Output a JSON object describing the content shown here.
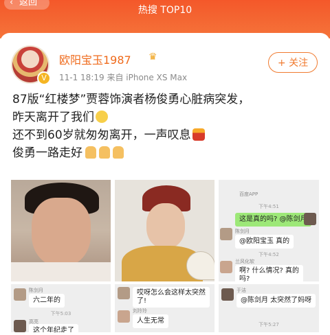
{
  "header": {
    "back_label": "返回",
    "subtitle": "热搜 TOP10"
  },
  "post": {
    "user": "欧阳宝玉1987",
    "time": "11-1 18:19",
    "source": "来自 iPhone XS Max",
    "follow_label": "+ 关注",
    "lines": [
      "87版“红楼梦”贾蓉饰演者杨俊勇心脏病突发，",
      "昨天离开了我们",
      "还不到60岁就匆匆离开，一声叹息",
      "俊勇一路走好"
    ]
  },
  "chat1": {
    "header_app": "百度APP",
    "time1": "下午4:51",
    "msg1": "这是真的吗? @陈剑月",
    "name1": "陈剑月",
    "msg2": "@欧阳宝玉 真的",
    "time2": "下午4:52",
    "name2": "兰风化软",
    "msg3a": "啊? 什么情况? 真的",
    "msg3b": "吗?"
  },
  "chat2": {
    "name": "陈剑月",
    "msg": "六二年的",
    "time": "下午5:03",
    "name2": "高亮",
    "msg2": "这个年纪走了"
  },
  "chat3": {
    "msg1": "哎呀怎么会这样太突然",
    "msg1b": "了!",
    "name": "刘玲玲",
    "msg2": "人生无常"
  },
  "chat4": {
    "name": "于洁",
    "msg": "@陈剑月 太突然了妈呀",
    "time": "下午5:27"
  }
}
